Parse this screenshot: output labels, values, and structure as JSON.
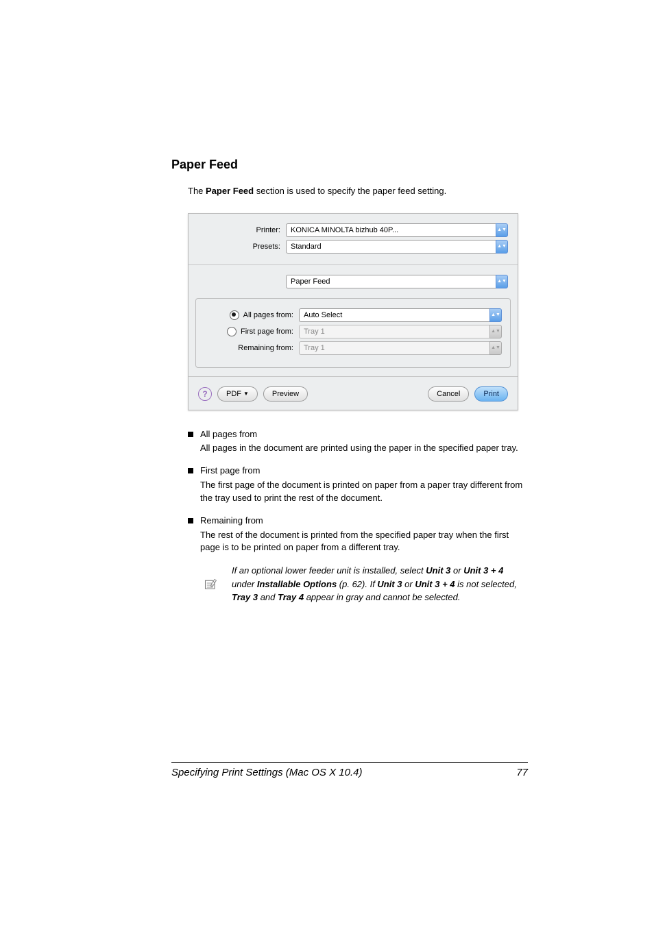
{
  "heading": "Paper Feed",
  "intro_pre": "The ",
  "intro_bold": "Paper Feed",
  "intro_post": " section is used to specify the paper feed setting.",
  "dialog": {
    "printer_label": "Printer:",
    "printer_value": "KONICA MINOLTA bizhub 40P...",
    "presets_label": "Presets:",
    "presets_value": "Standard",
    "pane_value": "Paper Feed",
    "all_label": "All pages from:",
    "all_value": "Auto Select",
    "first_label": "First page from:",
    "first_value": "Tray 1",
    "remaining_label": "Remaining from:",
    "remaining_value": "Tray 1",
    "help": "?",
    "pdf": "PDF",
    "preview": "Preview",
    "cancel": "Cancel",
    "print": "Print"
  },
  "items": [
    {
      "title": "All pages from",
      "body": "All pages in the document are printed using the paper in the specified paper tray."
    },
    {
      "title": "First page from",
      "body": "The first page of the document is printed on paper from a paper tray different from the tray used to print the rest of the document."
    },
    {
      "title": "Remaining from",
      "body": "The rest of the document is printed from the specified paper tray when the first page is to be printed on paper from a different tray."
    }
  ],
  "note": {
    "seg1": "If an optional lower feeder unit is installed, select ",
    "b1": "Unit 3",
    "seg2": " or ",
    "b2": "Unit 3 + 4",
    "seg3": " under ",
    "b3": "Installable Options",
    "seg4": " (p. 62). If ",
    "b4": "Unit 3",
    "seg5": " or ",
    "b5": "Unit 3 + 4",
    "seg6": " is not selected, ",
    "b6": "Tray 3",
    "seg7": " and ",
    "b7": "Tray 4",
    "seg8": " appear in gray and cannot be selected."
  },
  "footer": {
    "left": "Specifying Print Settings (Mac OS X 10.4)",
    "right": "77"
  }
}
